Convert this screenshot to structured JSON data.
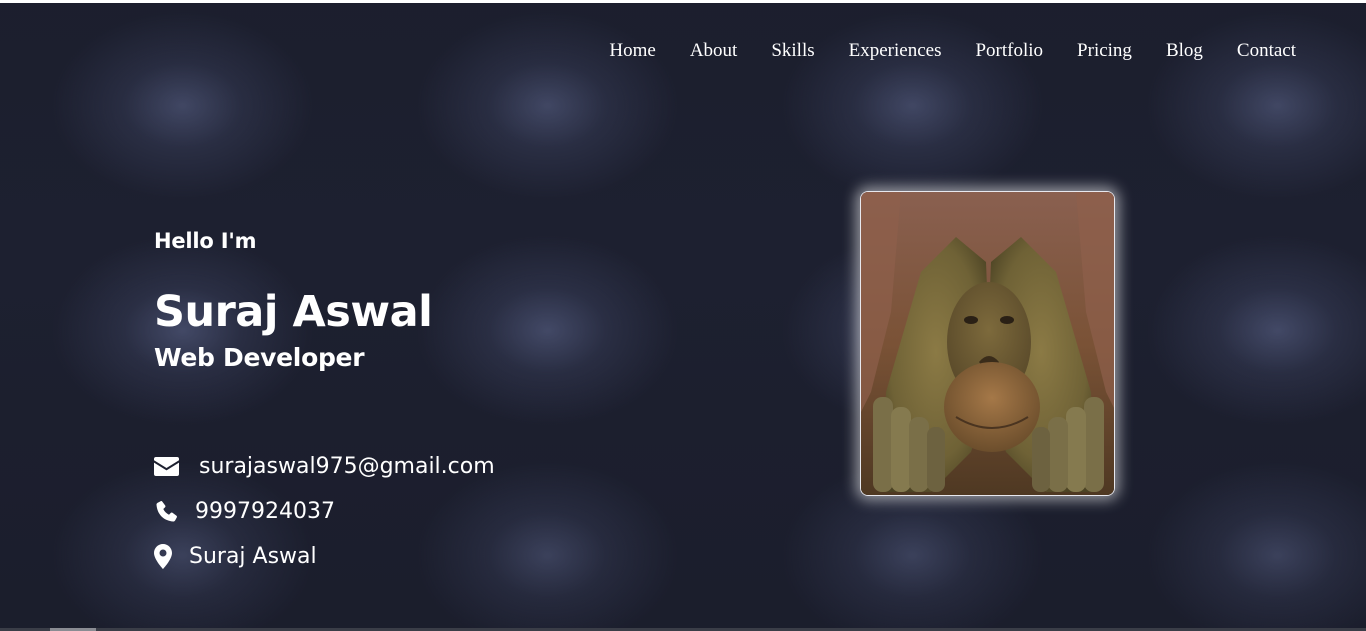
{
  "nav": {
    "items": [
      {
        "label": "Home"
      },
      {
        "label": "About"
      },
      {
        "label": "Skills"
      },
      {
        "label": "Experiences"
      },
      {
        "label": "Portfolio"
      },
      {
        "label": "Pricing"
      },
      {
        "label": "Blog"
      },
      {
        "label": "Contact"
      }
    ]
  },
  "hero": {
    "greeting": "Hello I'm",
    "name": "Suraj Aswal",
    "role": "Web Developer",
    "contacts": {
      "email": {
        "icon": "envelope-icon",
        "text": "surajaswal975@gmail.com"
      },
      "phone": {
        "icon": "phone-icon",
        "text": "9997924037"
      },
      "location": {
        "icon": "map-pin-icon",
        "text": "Suraj Aswal"
      }
    },
    "photo": {
      "icon": "orangutan-photo"
    }
  },
  "colors": {
    "background": "#1d2030",
    "text": "#ffffff",
    "photo_glow": "#ffffff"
  }
}
